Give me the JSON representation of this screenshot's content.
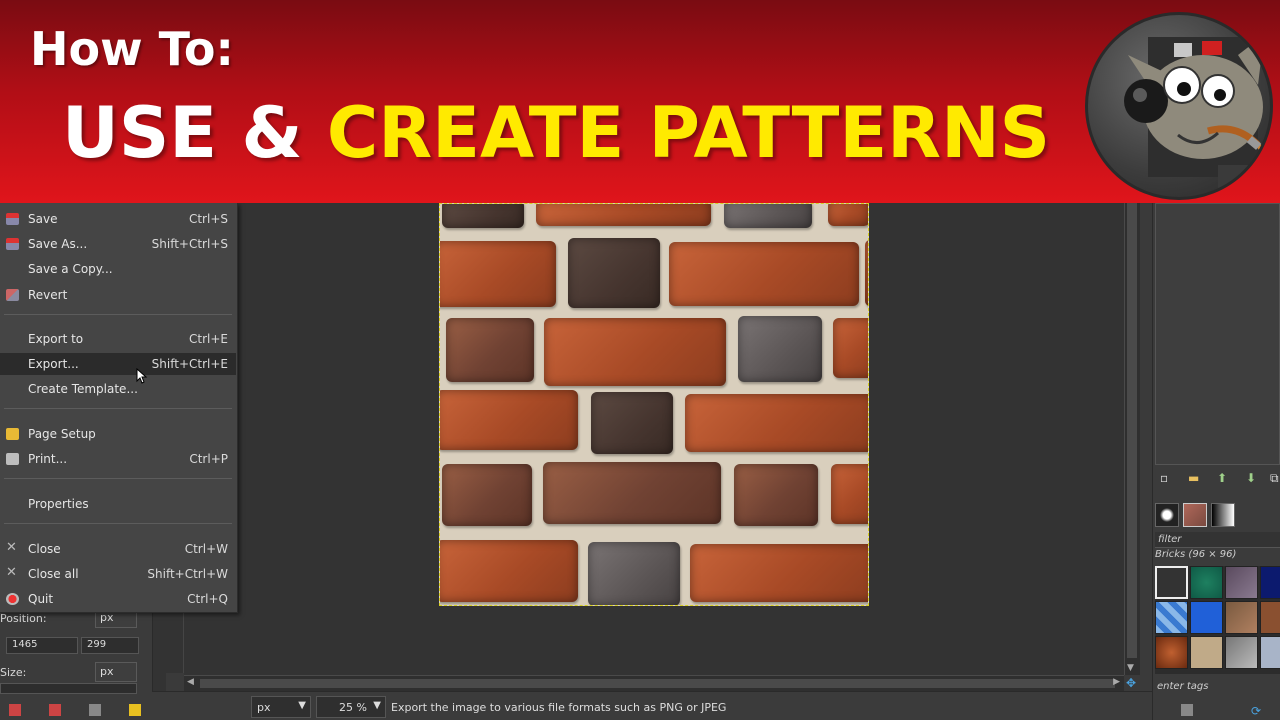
{
  "banner": {
    "line1": "How To:",
    "line2_white": "USE & ",
    "line2_yellow": "CREATE PATTERNS",
    "colors": {
      "background_top": "#7a0c12",
      "background_bottom": "#e0151b",
      "yellow": "#ffea00",
      "white": "#ffffff"
    }
  },
  "logo": {
    "icon": "gimp-mascot-icon"
  },
  "file_menu": {
    "items": [
      {
        "label": "Save",
        "shortcut": "Ctrl+S",
        "icon": "save-icon"
      },
      {
        "label": "Save As...",
        "shortcut": "Shift+Ctrl+S",
        "icon": "save-as-icon"
      },
      {
        "label": "Save a Copy...",
        "shortcut": "",
        "icon": ""
      },
      {
        "label": "Revert",
        "shortcut": "",
        "icon": "revert-icon"
      },
      {
        "label": "Export to",
        "shortcut": "Ctrl+E",
        "icon": ""
      },
      {
        "label": "Export...",
        "shortcut": "Shift+Ctrl+E",
        "icon": "",
        "highlighted": true
      },
      {
        "label": "Create Template...",
        "shortcut": "",
        "icon": ""
      },
      {
        "label": "Page Setup",
        "shortcut": "",
        "icon": "page-setup-icon"
      },
      {
        "label": "Print...",
        "shortcut": "Ctrl+P",
        "icon": "print-icon"
      },
      {
        "label": "Properties",
        "shortcut": "",
        "icon": ""
      },
      {
        "label": "Close",
        "shortcut": "Ctrl+W",
        "icon": "close-icon"
      },
      {
        "label": "Close all",
        "shortcut": "Shift+Ctrl+W",
        "icon": "close-all-icon"
      },
      {
        "label": "Quit",
        "shortcut": "Ctrl+Q",
        "icon": "quit-icon"
      }
    ]
  },
  "tool_options": {
    "position_label": "Position:",
    "position_unit": "px",
    "position_x": "1465",
    "position_y": "299",
    "size_label": "Size:",
    "size_unit": "px"
  },
  "status_bar": {
    "unit": "px",
    "zoom": "25 %",
    "message": "Export the image to various file formats such as PNG or JPEG"
  },
  "patterns_panel": {
    "filter_placeholder": "filter",
    "selected_pattern": "Bricks (96 × 96)",
    "tags_placeholder": "enter tags"
  }
}
